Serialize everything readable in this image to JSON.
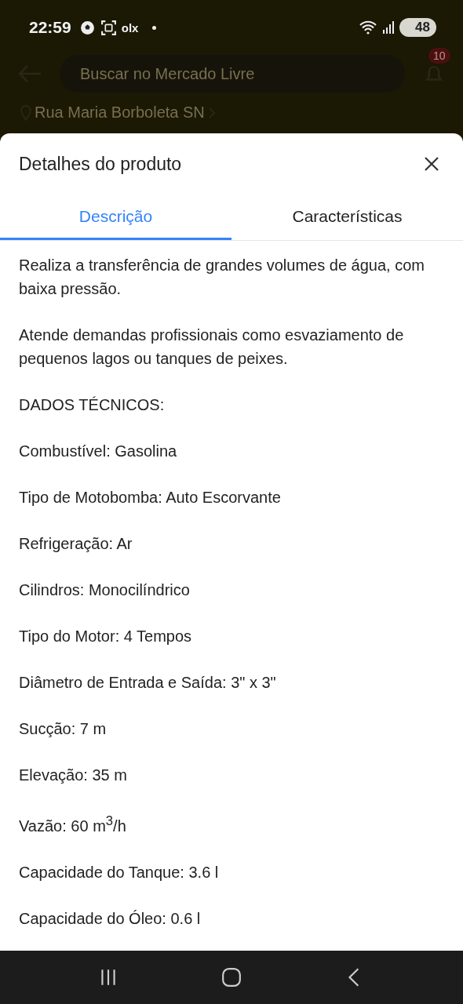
{
  "status_bar": {
    "time": "22:59",
    "app_label": "olx",
    "battery": "48"
  },
  "header": {
    "search": {
      "placeholder": "Buscar no Mercado Livre"
    },
    "notifications_badge": "10",
    "address": "Rua Maria Borboleta SN"
  },
  "sheet": {
    "title": "Detalhes do produto",
    "tabs": [
      {
        "label": "Descrição",
        "selected": true
      },
      {
        "label": "Características",
        "selected": false
      }
    ],
    "description": [
      "Realiza a transferência de grandes volumes de água, com baixa pressão.",
      "Atende demandas profissionais como esvaziamento de pequenos lagos ou tanques de peixes.",
      "DADOS TÉCNICOS:",
      "Combustível: Gasolina",
      "Tipo de Motobomba: Auto Escorvante",
      "Refrigeração: Ar",
      "Cilindros: Monocilíndrico",
      "Tipo do Motor: 4 Tempos",
      "Diâmetro de Entrada e Saída: 3\" x 3\"",
      "Sucção: 7 m",
      "Elevação: 35 m",
      "Vazão: 60 m$^{3}$/h",
      "Capacidade do Tanque: 3.6 l",
      "Capacidade do Óleo: 0.6 l"
    ]
  }
}
